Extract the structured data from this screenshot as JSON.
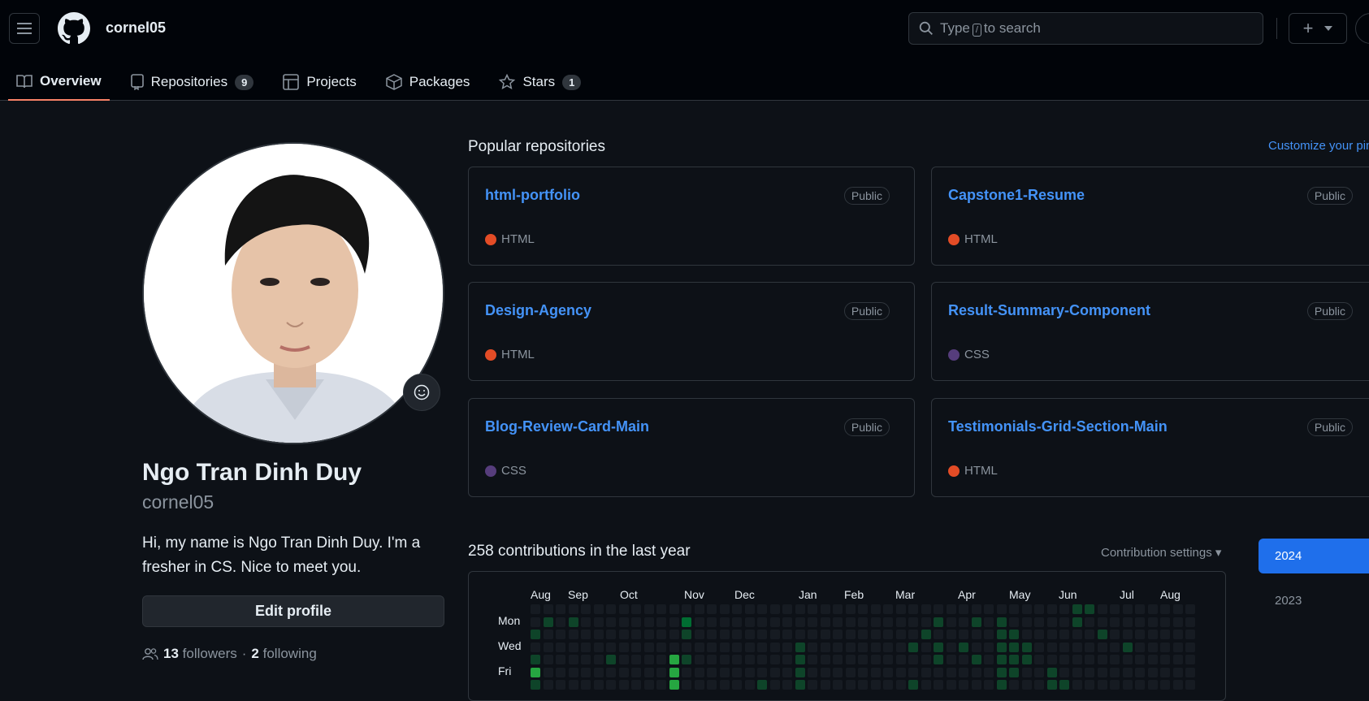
{
  "header": {
    "username": "cornel05",
    "search_prefix": "Type",
    "search_key": "/",
    "search_suffix": "to search"
  },
  "tabs": [
    {
      "label": "Overview",
      "icon": "book-icon"
    },
    {
      "label": "Repositories",
      "icon": "repo-icon",
      "count": "9"
    },
    {
      "label": "Projects",
      "icon": "table-icon"
    },
    {
      "label": "Packages",
      "icon": "package-icon"
    },
    {
      "label": "Stars",
      "icon": "star-icon",
      "count": "1"
    }
  ],
  "profile": {
    "full_name": "Ngo Tran Dinh Duy",
    "login": "cornel05",
    "bio": "Hi, my name is Ngo Tran Dinh Duy. I'm a fresher in CS. Nice to meet you.",
    "edit_label": "Edit profile",
    "followers_count": "13",
    "followers_label": "followers",
    "dot_sep": "·",
    "following_count": "2",
    "following_label": "following"
  },
  "popular": {
    "title": "Popular repositories",
    "customize": "Customize your pins",
    "repos": [
      {
        "name": "html-portfolio",
        "visibility": "Public",
        "language": "HTML",
        "color": "#e34c26"
      },
      {
        "name": "Capstone1-Resume",
        "visibility": "Public",
        "language": "HTML",
        "color": "#e34c26"
      },
      {
        "name": "Design-Agency",
        "visibility": "Public",
        "language": "HTML",
        "color": "#e34c26"
      },
      {
        "name": "Result-Summary-Component",
        "visibility": "Public",
        "language": "CSS",
        "color": "#563d7c"
      },
      {
        "name": "Blog-Review-Card-Main",
        "visibility": "Public",
        "language": "CSS",
        "color": "#563d7c"
      },
      {
        "name": "Testimonials-Grid-Section-Main",
        "visibility": "Public",
        "language": "HTML",
        "color": "#e34c26"
      }
    ]
  },
  "contributions": {
    "title": "258 contributions in the last year",
    "settings_label": "Contribution settings ▾",
    "months": [
      "Aug",
      "Sep",
      "Oct",
      "Nov",
      "Dec",
      "Jan",
      "Feb",
      "Mar",
      "Apr",
      "May",
      "Jun",
      "Jul",
      "Aug"
    ],
    "days": [
      "Mon",
      "Wed",
      "Fri"
    ],
    "years": [
      "2024",
      "2023"
    ]
  }
}
